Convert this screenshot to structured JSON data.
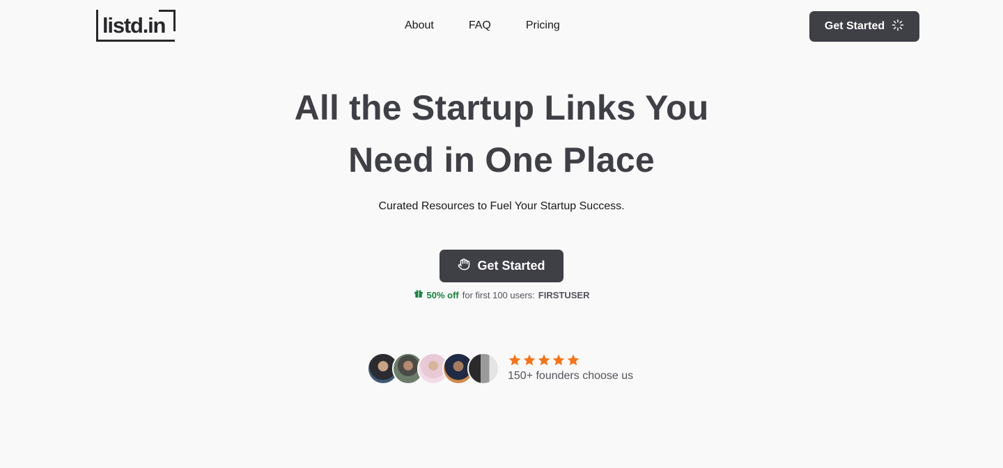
{
  "logo": {
    "text": "listd.in"
  },
  "nav": {
    "items": [
      {
        "label": "About"
      },
      {
        "label": "FAQ"
      },
      {
        "label": "Pricing"
      }
    ]
  },
  "header": {
    "cta_label": "Get Started"
  },
  "hero": {
    "title_line1": "All the Startup Links You",
    "title_line2": "Need in One Place",
    "subtitle": "Curated Resources to Fuel Your Startup Success.",
    "cta_label": "Get Started"
  },
  "promo": {
    "discount": "50% off",
    "text": "for first 100 users:",
    "code": "FIRSTUSER"
  },
  "social_proof": {
    "rating_stars": 5,
    "text": "150+ founders choose us",
    "avatar_count": 5
  },
  "colors": {
    "background": "#f9f9f9",
    "button": "#3f3f46",
    "star": "#f97316",
    "promo_green": "#15803d"
  }
}
